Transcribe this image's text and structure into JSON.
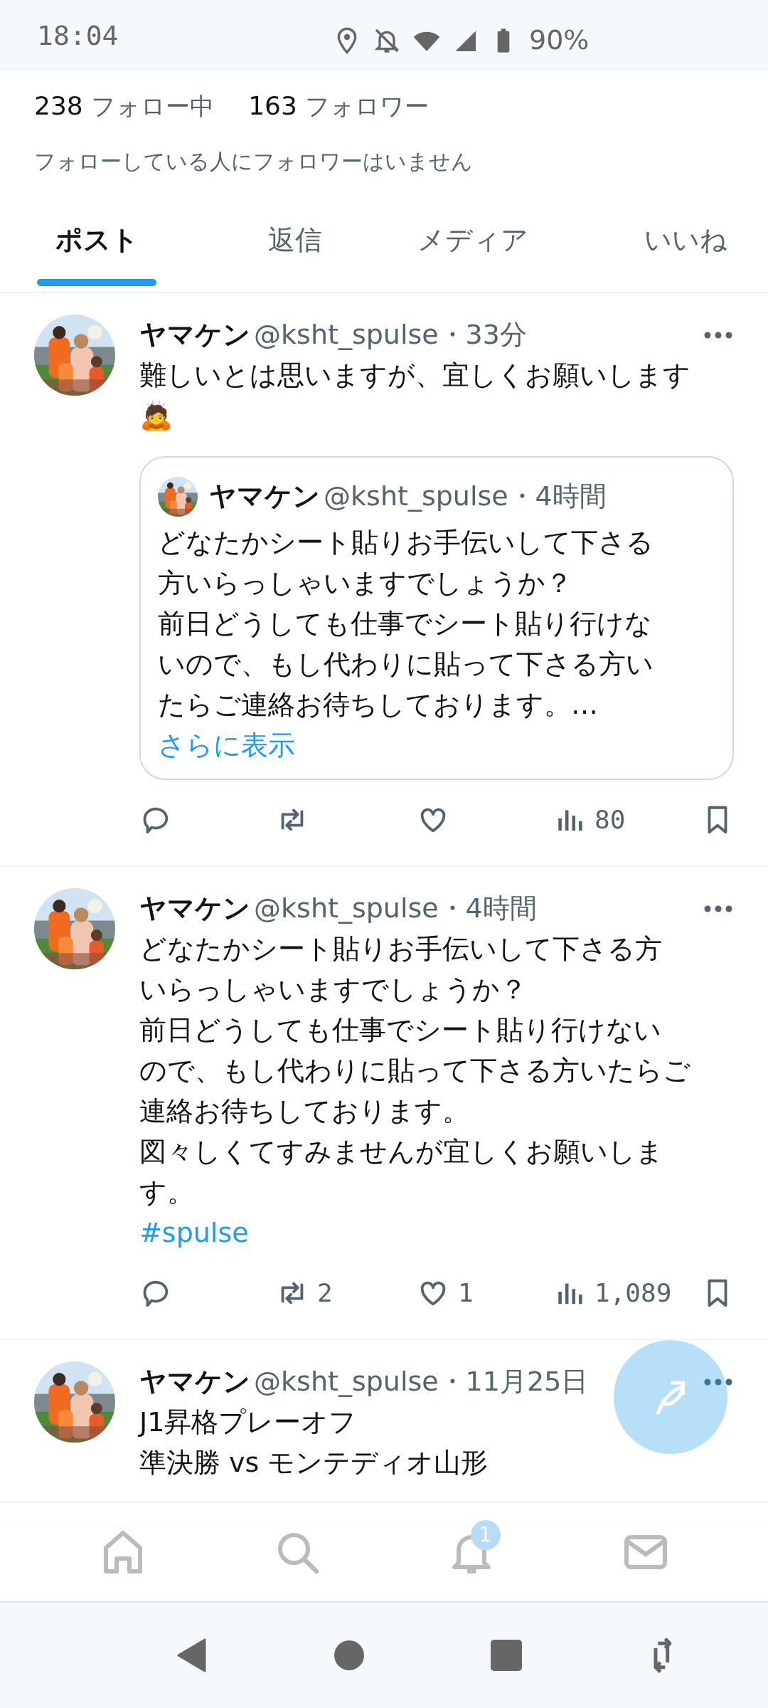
{
  "status_bar": {
    "time": "18:04",
    "battery": "90%"
  },
  "profile_stats": [
    {
      "count": "238",
      "label": "フォロー中"
    },
    {
      "count": "163",
      "label": "フォロワー"
    }
  ],
  "followers_note": "フォローしている人にフォロワーはいません",
  "tabs": [
    {
      "label": "ポスト",
      "selected": true
    },
    {
      "label": "返信",
      "selected": false
    },
    {
      "label": "メディア",
      "selected": false
    },
    {
      "label": "いいね",
      "selected": false
    }
  ],
  "posts": [
    {
      "name": "ヤマケン",
      "meta": "@ksht_spulse・33分",
      "body": [
        "難しいとは思いますが、宜しくお願いします",
        "🙇"
      ],
      "quote": {
        "name": "ヤマケン",
        "meta": "@ksht_spulse・4時間",
        "body": [
          "どなたかシート貼りお手伝いして下さる",
          "方いらっしゃいますでしょうか？",
          "前日どうしても仕事でシート貼り行けな",
          "いので、もし代わりに貼って下さる方い",
          "たらご連絡お待ちしております。…"
        ],
        "more": "さらに表示"
      },
      "actions": [
        {
          "kind": "reply"
        },
        {
          "kind": "repost"
        },
        {
          "kind": "like"
        },
        {
          "kind": "views",
          "count": "80"
        },
        {
          "kind": "bookmark"
        }
      ]
    },
    {
      "name": "ヤマケン",
      "meta": "@ksht_spulse・4時間",
      "body": [
        "どなたかシート貼りお手伝いして下さる方",
        "いらっしゃいますでしょうか？",
        "前日どうしても仕事でシート貼り行けない",
        "ので、もし代わりに貼って下さる方いたらご",
        "連絡お待ちしております。",
        "図々しくてすみませんが宜しくお願いしま",
        "す。"
      ],
      "hashtag": "#spulse",
      "actions": [
        {
          "kind": "reply"
        },
        {
          "kind": "repost",
          "count": "2"
        },
        {
          "kind": "like",
          "count": "1"
        },
        {
          "kind": "views",
          "count": "1,089"
        },
        {
          "kind": "bookmark"
        }
      ]
    },
    {
      "name": "ヤマケン",
      "meta": "@ksht_spulse・11月25日",
      "body": [
        "J1昇格プレーオフ",
        "準決勝 vs モンテディオ山形"
      ]
    }
  ],
  "bottom_nav": [
    {
      "kind": "home"
    },
    {
      "kind": "search"
    },
    {
      "kind": "notifications",
      "badge": "1"
    },
    {
      "kind": "messages"
    }
  ]
}
